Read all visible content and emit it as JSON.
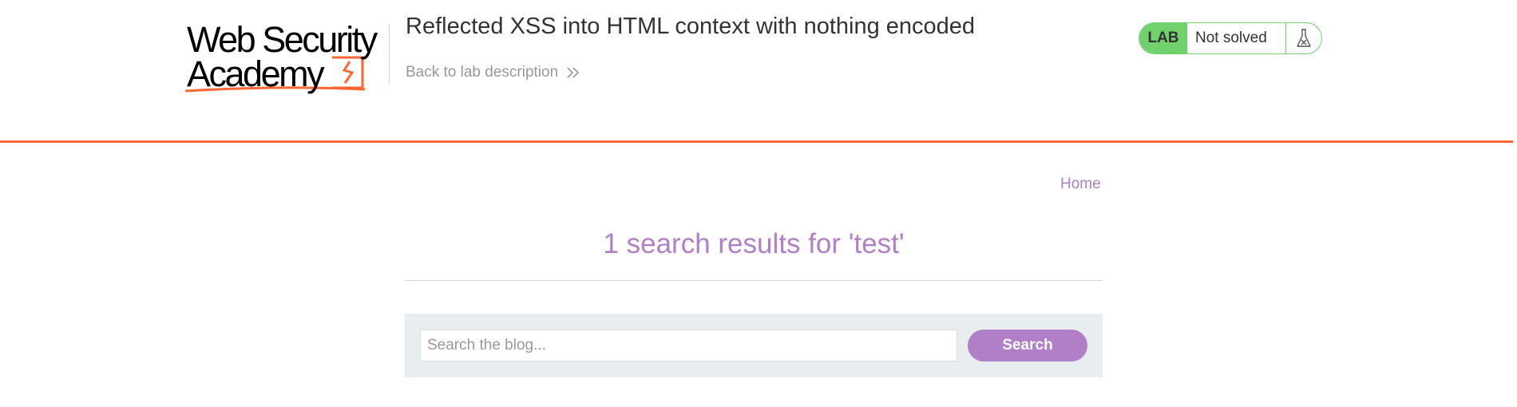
{
  "header": {
    "logo_line1": "Web Security",
    "logo_line2": "Academy",
    "lab_title": "Reflected XSS into HTML context with nothing encoded",
    "back_link": "Back to lab description",
    "back_icon": "double-chevron-right-icon",
    "status": {
      "badge": "LAB",
      "text": "Not solved",
      "icon": "flask-icon"
    }
  },
  "nav": {
    "home": "Home"
  },
  "results": {
    "heading": "1 search results for 'test'"
  },
  "search": {
    "placeholder": "Search the blog...",
    "value": "",
    "button": "Search"
  },
  "colors": {
    "accent_orange": "#ff6633",
    "purple": "#b07fc8",
    "status_green": "#70d16d",
    "panel_grey": "#e8edf0"
  }
}
